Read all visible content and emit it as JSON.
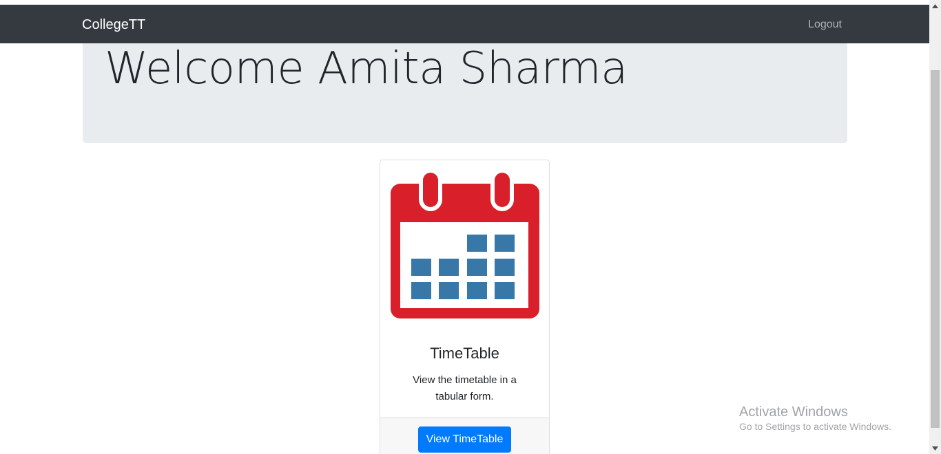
{
  "navbar": {
    "brand": "CollegeTT",
    "logout_label": "Logout",
    "background": "#343a40"
  },
  "jumbotron": {
    "heading": "Welcome Amita Sharma"
  },
  "card": {
    "image_icon": "calendar-icon",
    "title": "TimeTable",
    "text": "View the timetable in a tabular form.",
    "button_label": "View TimeTable",
    "accent": "#007bff",
    "calendar_red": "#d9202a",
    "calendar_cell": "#3778a8"
  },
  "watermark": {
    "title": "Activate Windows",
    "subtitle": "Go to Settings to activate Windows."
  }
}
